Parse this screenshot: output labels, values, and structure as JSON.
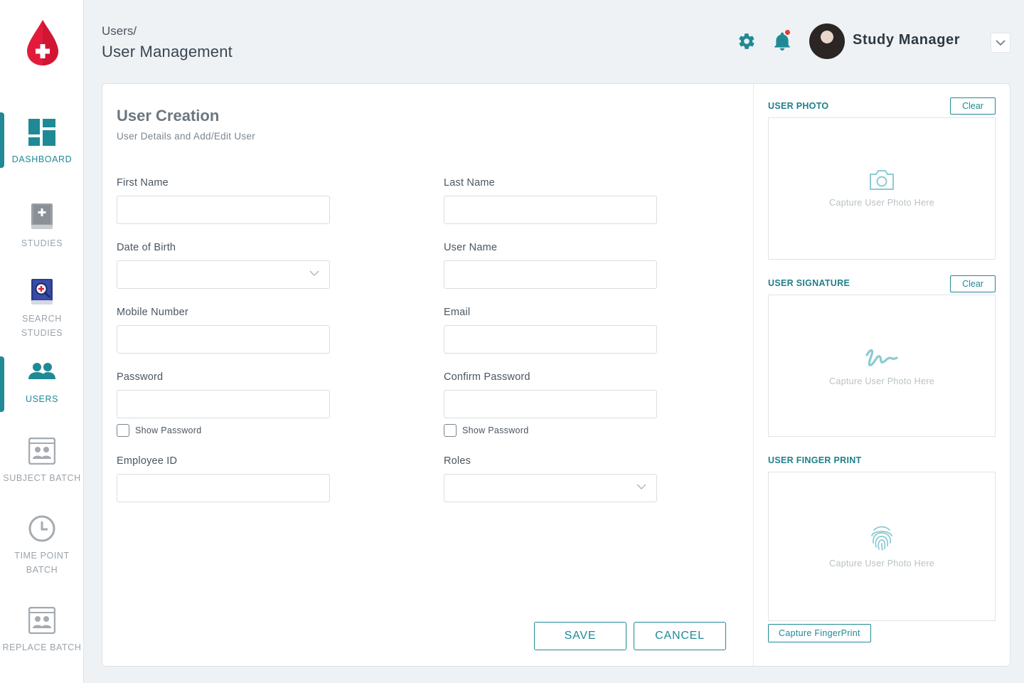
{
  "sidebar": {
    "items": [
      {
        "label": "DASHBOARD",
        "icon": "dashboard-icon",
        "active": true
      },
      {
        "label": "STUDIES",
        "icon": "studies-book-icon",
        "active": false
      },
      {
        "label": "SEARCH STUDIES",
        "icon": "search-studies-icon",
        "active": false
      },
      {
        "label": "USERS",
        "icon": "users-icon",
        "active": true
      },
      {
        "label": "SUBJECT BATCH",
        "icon": "subject-batch-icon",
        "active": false
      },
      {
        "label": "TIME POINT BATCH",
        "icon": "clock-icon",
        "active": false
      },
      {
        "label": "REPLACE BATCH",
        "icon": "replace-batch-icon",
        "active": false
      }
    ]
  },
  "header": {
    "breadcrumb": "Users/",
    "title": "User Management",
    "user_name": "Study Manager"
  },
  "form": {
    "title": "User Creation",
    "subtitle": "User Details and Add/Edit User",
    "fields": {
      "first_name": {
        "label": "First Name",
        "value": ""
      },
      "last_name": {
        "label": "Last Name",
        "value": ""
      },
      "dob": {
        "label": "Date of Birth",
        "value": ""
      },
      "user_name": {
        "label": "User Name",
        "value": ""
      },
      "mobile": {
        "label": "Mobile Number",
        "value": ""
      },
      "email": {
        "label": "Email",
        "value": ""
      },
      "password": {
        "label": "Password",
        "value": ""
      },
      "confirm_password": {
        "label": "Confirm Password",
        "value": ""
      },
      "employee_id": {
        "label": "Employee ID",
        "value": ""
      },
      "roles": {
        "label": "Roles",
        "value": ""
      }
    },
    "show_password_label": "Show Password",
    "save_label": "SAVE",
    "cancel_label": "CANCEL"
  },
  "right_panel": {
    "photo": {
      "label": "USER PHOTO",
      "clear": "Clear",
      "hint": "Capture User Photo Here"
    },
    "signature": {
      "label": "USER SIGNATURE",
      "clear": "Clear",
      "hint": "Capture User Photo Here"
    },
    "fingerprint": {
      "label": "USER FINGER PRINT",
      "hint": "Capture User Photo Here",
      "button": "Capture FingerPrint"
    }
  },
  "colors": {
    "accent": "#1f8a96",
    "notification": "#e53935",
    "logo_red": "#e31b3b"
  }
}
